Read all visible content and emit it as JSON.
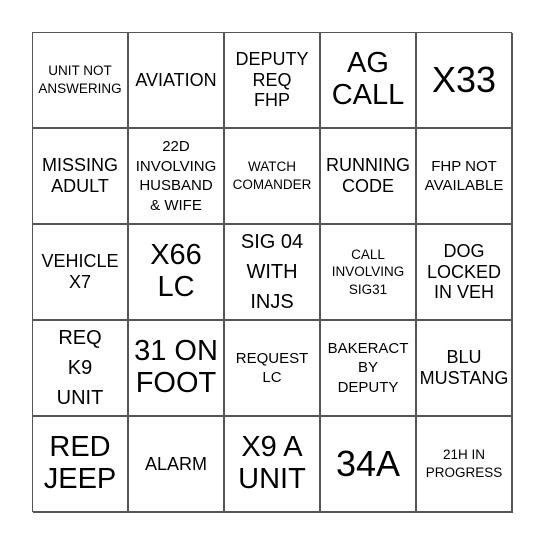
{
  "board": {
    "rows": [
      [
        {
          "text": "UNIT NOT\nANSWERING",
          "size": "s-xs"
        },
        {
          "text": "AVIATION",
          "size": "s-md"
        },
        {
          "text": "DEPUTY\nREQ\nFHP",
          "size": "s-md"
        },
        {
          "text": "AG\nCALL",
          "size": "s-xl"
        },
        {
          "text": "X33",
          "size": "s-xxl"
        }
      ],
      [
        {
          "text": "MISSING\nADULT",
          "size": "s-md"
        },
        {
          "text": "22D\nINVOLVING\nHUSBAND\n& WIFE",
          "size": "s-sm"
        },
        {
          "text": "WATCH\nCOMANDER",
          "size": "s-xs"
        },
        {
          "text": "RUNNING\nCODE",
          "size": "s-md"
        },
        {
          "text": "FHP NOT\nAVAILABLE",
          "size": "s-sm"
        }
      ],
      [
        {
          "text": "VEHICLE\nX7",
          "size": "s-md"
        },
        {
          "text": "X66\nLC",
          "size": "s-xl"
        },
        {
          "text": "SIG 04\nWITH\nINJS",
          "size": "s-lg"
        },
        {
          "text": "CALL\nINVOLVING\nSIG31",
          "size": "s-xs"
        },
        {
          "text": "DOG\nLOCKED\nIN VEH",
          "size": "s-md"
        }
      ],
      [
        {
          "text": "REQ\nK9\nUNIT",
          "size": "s-lg"
        },
        {
          "text": "31 ON\nFOOT",
          "size": "s-xl"
        },
        {
          "text": "REQUEST\nLC",
          "size": "s-sm"
        },
        {
          "text": "BAKERACT\nBY\nDEPUTY",
          "size": "s-sm"
        },
        {
          "text": "BLU\nMUSTANG",
          "size": "s-md"
        }
      ],
      [
        {
          "text": "RED\nJEEP",
          "size": "s-xl"
        },
        {
          "text": "ALARM",
          "size": "s-md"
        },
        {
          "text": "X9 A\nUNIT",
          "size": "s-xl"
        },
        {
          "text": "34A",
          "size": "s-xxl"
        },
        {
          "text": "21H IN\nPROGRESS",
          "size": "s-xs"
        }
      ]
    ]
  },
  "colors": {
    "grid_line": "#555555",
    "text": "#000000",
    "background": "#ffffff"
  }
}
